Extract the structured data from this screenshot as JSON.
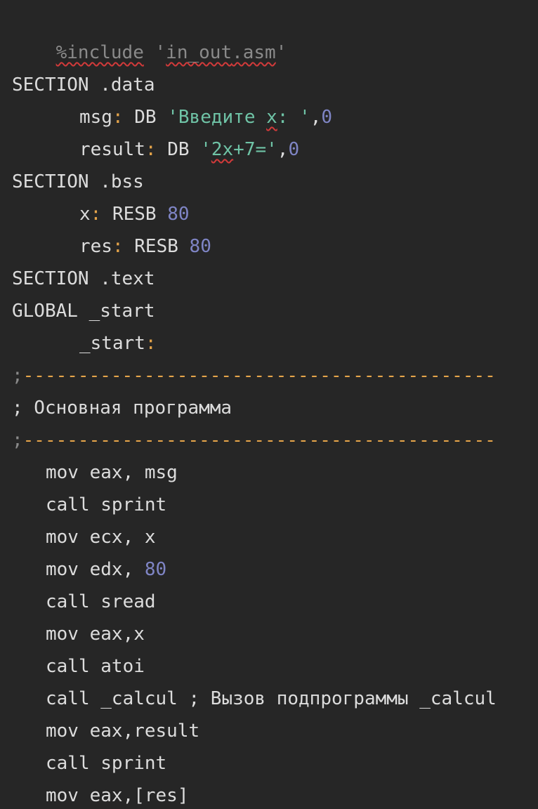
{
  "editor": {
    "colors": {
      "background": "#262626",
      "text": "#dcdcdc",
      "string": "#6fc3a6",
      "number": "#7f85c5",
      "punctuation": "#e5a44a",
      "dimmed": "#8a8a8a",
      "spell_error": "#d23a3a"
    },
    "lines": {
      "l1": {
        "directive": "%include",
        "space": " ",
        "q1": "'",
        "file_a": "in_out",
        "file_b": ".asm",
        "q2": "'"
      },
      "l2": {},
      "l3": {
        "text": "SECTION .data"
      },
      "l4": {
        "label": "msg",
        "colon": ":",
        "op": " DB ",
        "str_a": "'Введите ",
        "str_x": "x",
        "str_b": ": '",
        "comma": ",",
        "num": "0"
      },
      "l5": {
        "label": "result",
        "colon": ":",
        "op": " DB ",
        "str_a": "'",
        "str_x": "2x",
        "str_b": "+7='",
        "comma": ",",
        "num": "0"
      },
      "l6": {
        "text": "SECTION .bss"
      },
      "l7": {
        "label": "x",
        "colon": ":",
        "op": " RESB ",
        "num": "80"
      },
      "l8": {
        "label": "res",
        "colon": ":",
        "op": " RESB ",
        "num": "80"
      },
      "l9": {
        "text": "SECTION .text"
      },
      "l10": {
        "text": "GLOBAL _start"
      },
      "l11": {
        "label": "_start",
        "colon": ":"
      },
      "l12": {
        "semi": ";",
        "dashes": "-------------------------------------------"
      },
      "l13": {
        "text": "; Основная программа"
      },
      "l14": {
        "semi": ";",
        "dashes": "-------------------------------------------"
      },
      "l15": {
        "text": "mov eax, msg"
      },
      "l16": {
        "text": "call sprint"
      },
      "l17": {
        "text": "mov ecx, x"
      },
      "l18": {
        "text": "mov edx, ",
        "num": "80"
      },
      "l19": {
        "text": "call sread"
      },
      "l20": {
        "text": "mov eax,x"
      },
      "l21": {
        "text": "call atoi"
      },
      "l22": {
        "text": "call _calcul ; Вызов подпрограммы _calcul"
      },
      "l23": {
        "text": "mov eax,result"
      },
      "l24": {
        "text": "call sprint"
      },
      "l25": {
        "text": "mov eax,[res]"
      }
    }
  }
}
